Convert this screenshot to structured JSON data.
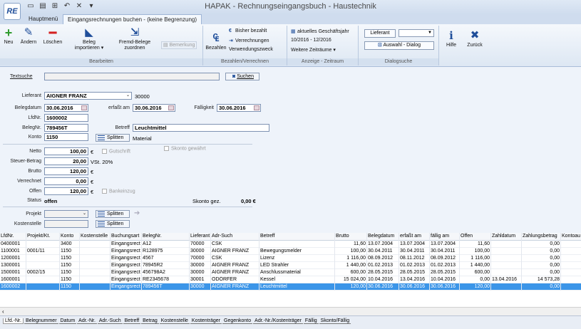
{
  "app": {
    "logo": "RE",
    "title": "HAPAK - Rechnungseingangsbuch - Haustechnik",
    "qat_icons": [
      "save-icon",
      "print-icon",
      "chart-icon",
      "undo-icon",
      "close-icon",
      "dropdown-icon"
    ]
  },
  "tabs": [
    "Hauptmenü",
    "Eingangsrechnungen buchen - (keine Begrenzung)"
  ],
  "ribbon": {
    "bearbeiten": {
      "label": "Bearbeiten",
      "neu": "Neu",
      "aendern": "Ändern",
      "loeschen": "Löschen",
      "beleg1": "Beleg",
      "beleg2": "importieren ▾",
      "fremd1": "Fremd-Belege",
      "fremd2": "zuordnen",
      "bemerkung": "Bemerkung"
    },
    "bezahlen": {
      "label": "Bezahlen/Verrechnen",
      "bezahlen": "Bezahlen",
      "bisher": "Bisher bezahlt",
      "verrechnungen": "Verrechnungen",
      "verwendungszweck": "Verwendungszweck"
    },
    "anzeige": {
      "label": "Anzeige - Zeitraum",
      "aktuell": "aktuelles Geschäftsjahr",
      "zeitraum": "10/2016 - 12/2016",
      "weitere": "Weitere Zeiträume ▾"
    },
    "dialogsuche": {
      "label": "Dialogsuche",
      "lieferant": "Lieferant",
      "auswahl": "Auswahl - Dialog"
    },
    "hilfe": "Hilfe",
    "zurueck": "Zurück"
  },
  "form": {
    "textsuche_label": "Textsuche",
    "suchen": "Suchen",
    "lieferant_label": "Lieferant",
    "lieferant": "AIGNER FRANZ",
    "lieferant_nr": "30000",
    "belegdatum_label": "Belegdatum",
    "belegdatum": "30.06.2016",
    "erfasst_label": "erfaßt am",
    "erfasst": "30.06.2016",
    "faelligkeit_label": "Fälligkeit",
    "faelligkeit": "30.06.2016",
    "lfdnr_label": "LfdNr.",
    "lfdnr": "1600002",
    "belegnr_label": "BelegNr.",
    "belegnr": "789456T",
    "betreff_label": "Betreff",
    "betreff": "Leuchtmittel",
    "konto_label": "Konto",
    "konto": "1150",
    "splitten": "Splitten",
    "konto_text": "Material",
    "netto_label": "Netto",
    "netto": "100,00",
    "currency": "€",
    "gutschrift": "Gutschrift",
    "skonto_gewaehrt": "Skonto gewährt",
    "steuer_label": "Steuer-Betrag",
    "steuer": "20,00",
    "steuer_text": "VSt. 20%",
    "brutto_label": "Brutto",
    "brutto": "120,00",
    "verrechnet_label": "Verrechnet",
    "verrechnet": "0,00",
    "offen_label": "Offen",
    "offen": "120,00",
    "bankeinzug": "Bankeinzug",
    "status_label": "Status",
    "status": "offen",
    "skonto_label": "Skonto gez.",
    "skonto": "0,00 €",
    "projekt_label": "Projekt",
    "kostenstelle_label": "Kostenstelle"
  },
  "table": {
    "headers": [
      "LfdNr.",
      "Projekt/Kt.",
      "Konto",
      "Kostenstelle",
      "Buchungsart",
      "BelegNr.",
      "Lieferant",
      "Adr-Such",
      "Betreff",
      "Brutto",
      "Belegdatum",
      "erfaßt am",
      "fällig am",
      "Offen",
      "Zahldatum",
      "Zahlungsbetrag",
      "Kontoau"
    ],
    "rows": [
      [
        "0400001",
        "",
        "3400",
        "",
        "Eingangsrect",
        "A12",
        "70000",
        "CSK",
        "",
        "11,60",
        "13.07.2004",
        "13.07.2004",
        "13.07.2004",
        "11,60",
        "",
        "0,00",
        ""
      ],
      [
        "1100001",
        "0001/11",
        "1150",
        "",
        "Eingangsrect",
        "R128975",
        "30000",
        "AIGNER FRANZ",
        "Bewegungsmelder",
        "100,00",
        "30.04.2011",
        "30.04.2011",
        "30.04.2011",
        "100,00",
        "",
        "0,00",
        ""
      ],
      [
        "1200001",
        "",
        "1150",
        "",
        "Eingangsrect",
        "4567",
        "70000",
        "CSK",
        "Lizenz",
        "1 116,00",
        "08.09.2012",
        "08.11.2012",
        "08.09.2012",
        "1 116,00",
        "",
        "0,00",
        ""
      ],
      [
        "1300001",
        "",
        "1150",
        "",
        "Eingangsrect",
        "78945R2",
        "30000",
        "AIGNER FRANZ",
        "LED Strahler",
        "1 440,00",
        "01.02.2013",
        "01.02.2013",
        "01.02.2013",
        "1 440,00",
        "",
        "0,00",
        ""
      ],
      [
        "1500001",
        "0002/15",
        "1150",
        "",
        "Eingangsrect",
        "456798A2",
        "30000",
        "AIGNER FRANZ",
        "Anschlussmaterial",
        "600,00",
        "28.05.2015",
        "28.05.2015",
        "28.05.2015",
        "600,00",
        "",
        "0,00",
        ""
      ],
      [
        "1600001",
        "",
        "1150",
        "",
        "Eingangsrect",
        "RE2345678",
        "30001",
        "ODÖRFER",
        "Kessel",
        "15 024,00",
        "10.04.2016",
        "13.04.2016",
        "10.04.2016",
        "0,00",
        "13.04.2016",
        "14 573,28",
        ""
      ],
      [
        "1600002",
        "",
        "1150",
        "",
        "Eingangsrect",
        "789456T",
        "30000",
        "AIGNER FRANZ",
        "Leuchtmittel",
        "120,00",
        "30.06.2016",
        "30.06.2016",
        "30.06.2016",
        "120,00",
        "",
        "0,00",
        ""
      ]
    ]
  },
  "sort_tabs": [
    "Lfd.-Nr.",
    "Belegnummer",
    "Datum",
    "Adr.-Nr.",
    "Adr.-Such",
    "Betreff",
    "Betrag",
    "Kostenstelle",
    "Kostenträger",
    "Gegenkonto",
    "Adr.-Nr./Kostenträger",
    "Fällig",
    "Skonto/Fällig"
  ],
  "colors": {
    "accent": "#1f4e9a",
    "selected_row": "#3b95e8",
    "add": "#2e9b2e",
    "delete": "#d42020"
  }
}
